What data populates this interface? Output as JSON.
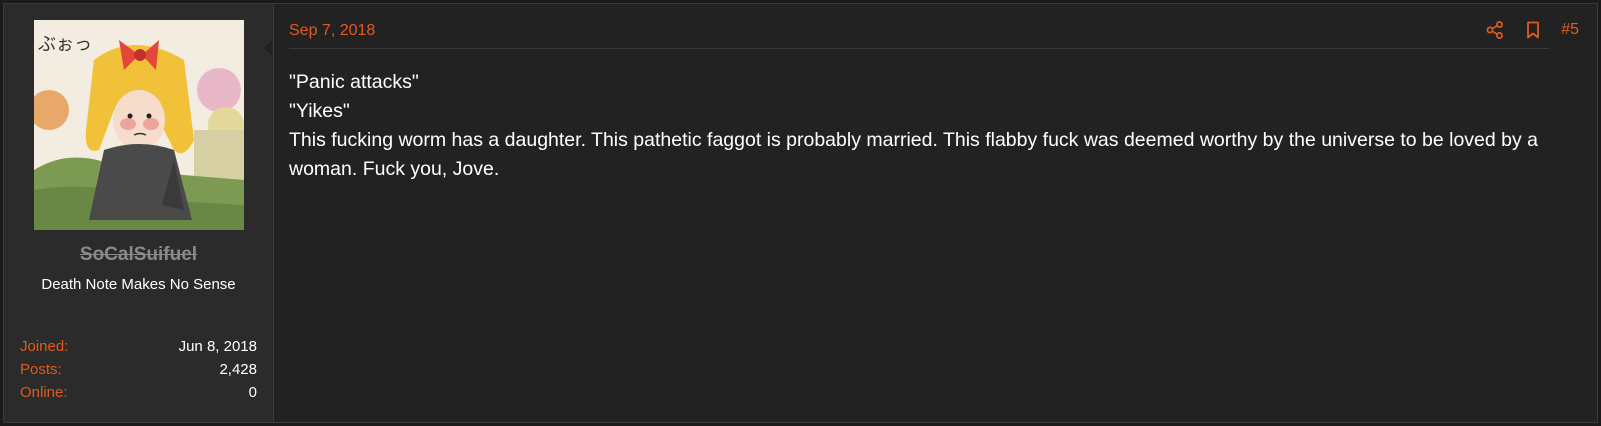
{
  "user": {
    "username": "SoCalSuifuel",
    "title": "Death Note Makes No Sense",
    "stats": [
      {
        "label": "Joined:",
        "value": "Jun 8, 2018"
      },
      {
        "label": "Posts:",
        "value": "2,428"
      },
      {
        "label": "Online:",
        "value": "0"
      }
    ]
  },
  "post": {
    "date": "Sep 7, 2018",
    "number": "#5",
    "lines": [
      "\"Panic attacks\"",
      "\"Yikes\"",
      "This fucking worm has a daughter. This pathetic faggot is probably married. This flabby fuck was deemed worthy by the universe to be loved by a woman. Fuck you, Jove."
    ]
  },
  "icons": {
    "share": "share-icon",
    "bookmark": "bookmark-icon"
  },
  "colors": {
    "accent": "#e35a1c",
    "background": "#222222",
    "sidebar": "#2b2b2b",
    "text": "#ffffff"
  }
}
